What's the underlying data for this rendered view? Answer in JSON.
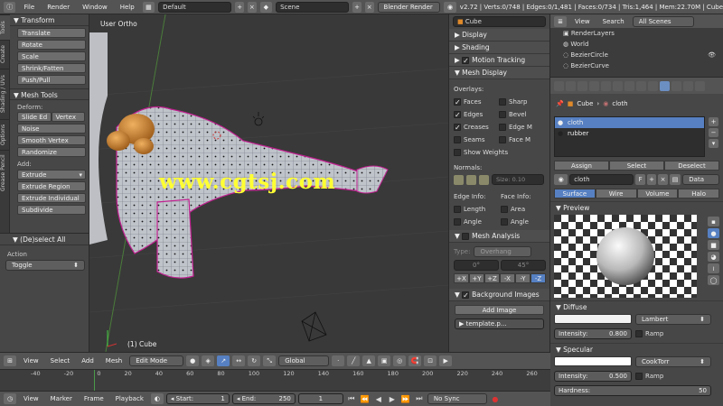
{
  "topbar": {
    "menus": [
      "File",
      "Render",
      "Window",
      "Help"
    ],
    "layout": "Default",
    "scene": "Scene",
    "engine": "Blender Render",
    "stats": "v2.72 | Verts:0/748 | Edges:0/1,481 | Faces:0/734 | Tris:1,464 | Mem:22.70M | Cube"
  },
  "tabs": [
    "Tools",
    "Create",
    "Shading / UVs",
    "Options",
    "Grease Pencil"
  ],
  "toolshelf": {
    "transform_title": "Transform",
    "transform_buttons": [
      "Translate",
      "Rotate",
      "Scale",
      "Shrink/Fatten",
      "Push/Pull"
    ],
    "meshtools_title": "Mesh Tools",
    "deform_label": "Deform:",
    "deform_pair": [
      "Slide Ed",
      "Vertex"
    ],
    "deform_buttons": [
      "Noise",
      "Smooth Vertex",
      "Randomize"
    ],
    "add_label": "Add:",
    "add_buttons": [
      "Extrude",
      "Extrude Region",
      "Extrude Individual",
      "Subdivide"
    ]
  },
  "operator": {
    "title": "(De)select All",
    "action_label": "Action",
    "action_value": "Toggle"
  },
  "viewport": {
    "view_name": "User Ortho",
    "object_label": "(1) Cube",
    "watermark": "www.cgtsj.com"
  },
  "npanel": {
    "object_name": "Cube",
    "display": "Display",
    "shading": "Shading",
    "motion_tracking": "Motion Tracking",
    "mesh_display": "Mesh Display",
    "overlays_label": "Overlays:",
    "overlays_left": [
      "Faces",
      "Edges",
      "Creases",
      "Seams"
    ],
    "overlays_right": [
      "Sharp",
      "Bevel",
      "Edge M",
      "Face M"
    ],
    "show_weights": "Show Weights",
    "normals_label": "Normals:",
    "size_label": "Size:",
    "size_value": "0.10",
    "edge_info": "Edge Info:",
    "face_info": "Face Info:",
    "info_left": [
      "Length",
      "Angle"
    ],
    "info_right": [
      "Area",
      "Angle"
    ],
    "mesh_analysis": "Mesh Analysis",
    "type_label": "Type:",
    "type_value": "Overhang",
    "angle_a": "0°",
    "angle_b": "45°",
    "axes": [
      "+X",
      "+Y",
      "+Z",
      "-X",
      "-Y",
      "-Z"
    ],
    "bg_images": "Background Images",
    "add_image": "Add Image",
    "template": "template.p..."
  },
  "outliner": {
    "view": "View",
    "search": "Search",
    "scenes": "All Scenes",
    "rows": [
      "RenderLayers",
      "World",
      "BezierCircle",
      "BezierCurve"
    ]
  },
  "props": {
    "context_object": "Cube",
    "context_material": "cloth",
    "slots": [
      "cloth",
      "rubber"
    ],
    "slot_buttons": [
      "Assign",
      "Select",
      "Deselect"
    ],
    "material_name": "cloth",
    "material_users": "F",
    "data_label": "Data",
    "preview_tabs": [
      "Surface",
      "Wire",
      "Volume",
      "Halo"
    ],
    "preview_title": "Preview",
    "diffuse_title": "Diffuse",
    "diffuse_shader": "Lambert",
    "intensity_label": "Intensity:",
    "diffuse_intensity": "0.800",
    "ramp_label": "Ramp",
    "specular_title": "Specular",
    "specular_shader": "CookTorr",
    "specular_intensity": "0.500",
    "hardness_label": "Hardness:",
    "hardness_value": "50"
  },
  "vpheader": {
    "menus": [
      "View",
      "Select",
      "Add",
      "Mesh"
    ],
    "mode": "Edit Mode",
    "orientation": "Global"
  },
  "ruler": {
    "ticks": [
      "-40",
      "-20",
      "0",
      "20",
      "40",
      "60",
      "80",
      "100",
      "120",
      "140",
      "160",
      "180",
      "200",
      "220",
      "240",
      "260"
    ]
  },
  "timeline": {
    "menus": [
      "View",
      "Marker",
      "Frame",
      "Playback"
    ],
    "start_label": "Start:",
    "start_value": "1",
    "end_label": "End:",
    "end_value": "250",
    "current_frame": "1",
    "sync": "No Sync"
  }
}
